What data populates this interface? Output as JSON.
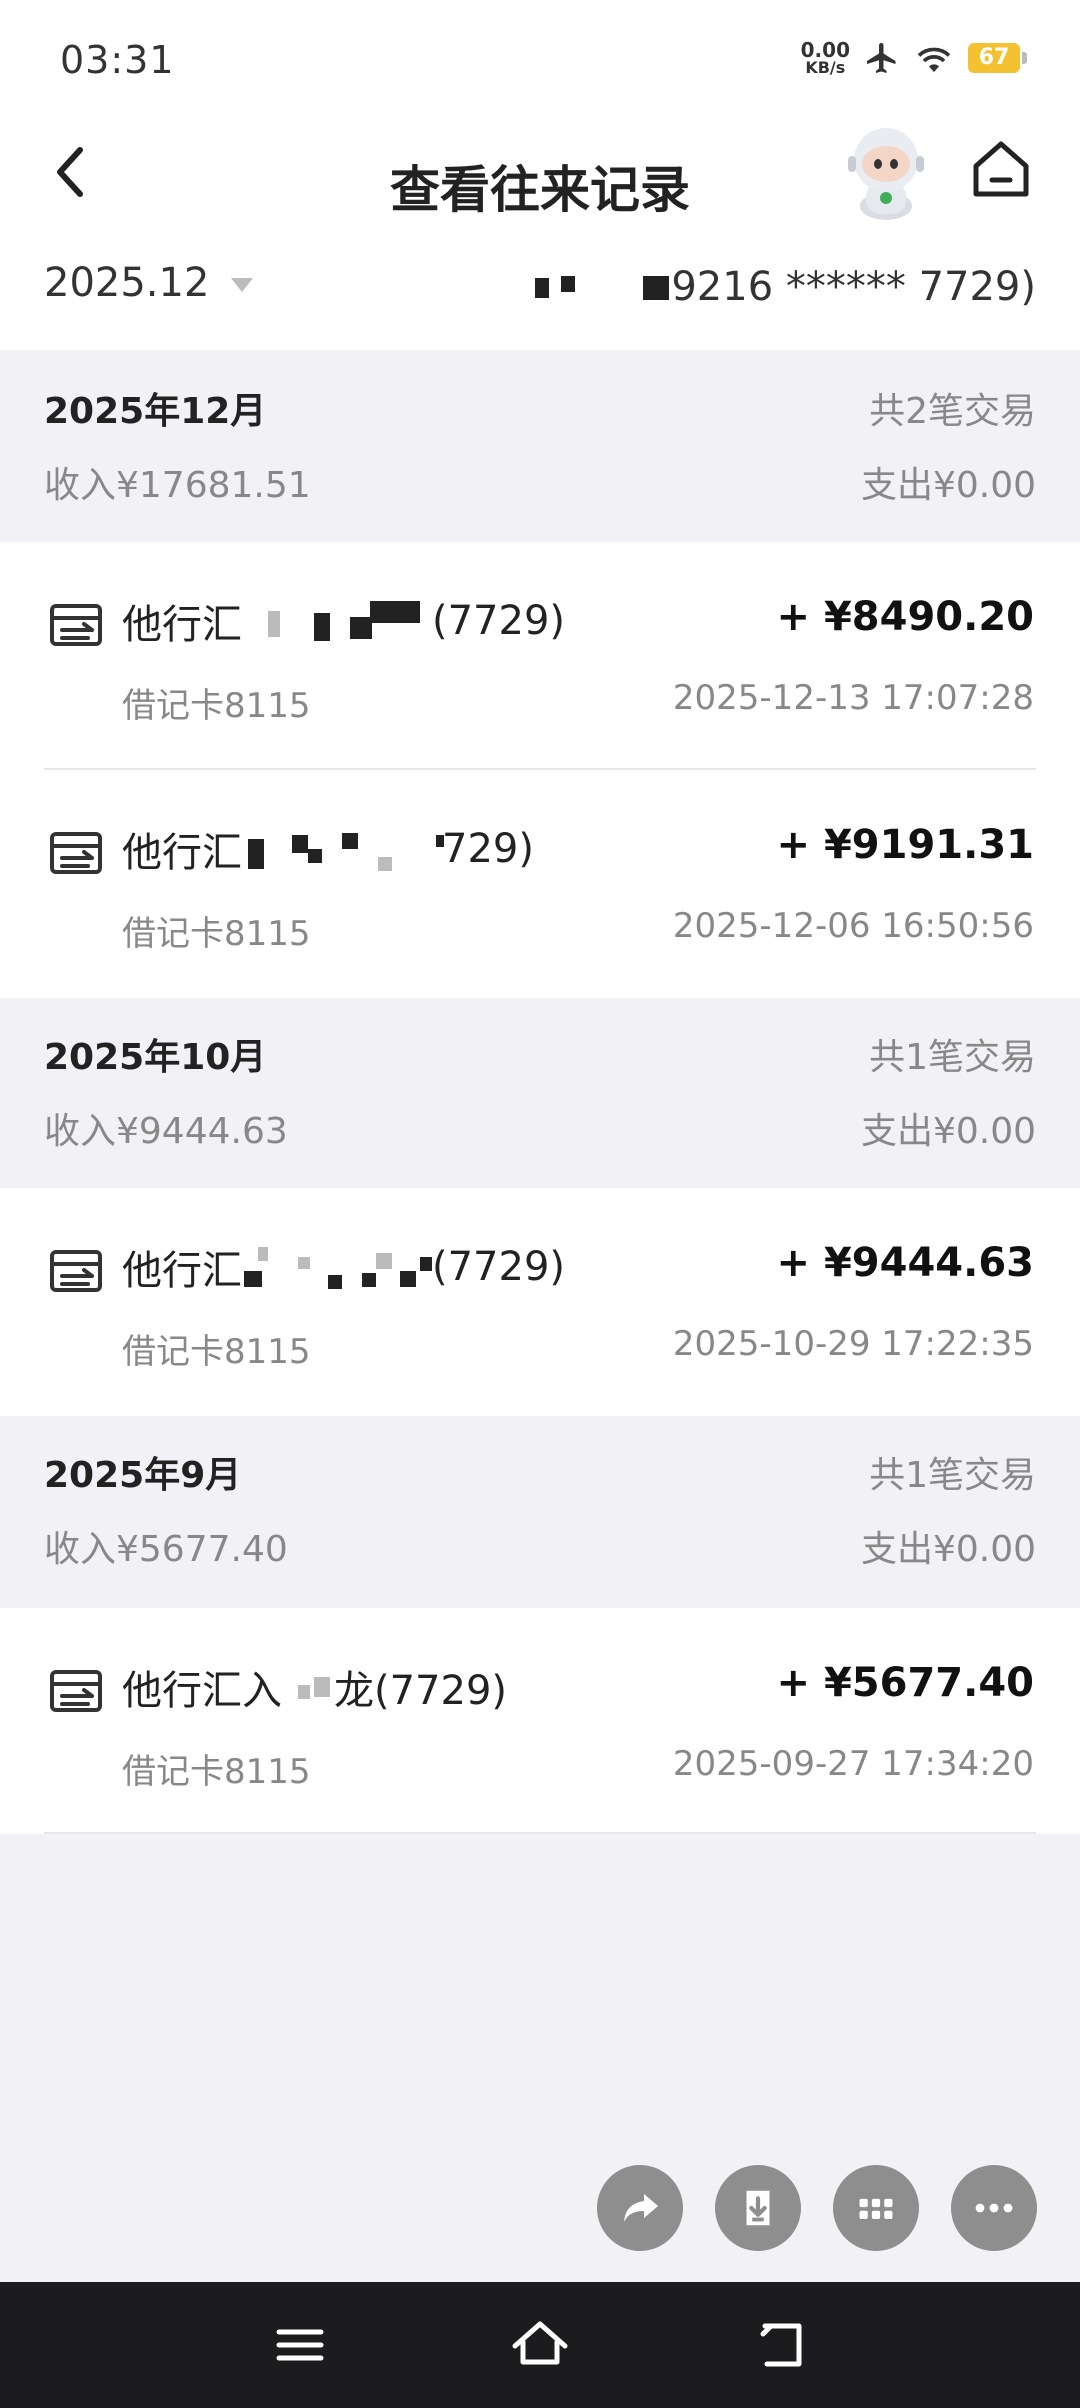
{
  "status_bar": {
    "time": "03:31",
    "net_speed_value": "0.00",
    "net_speed_unit": "KB/s",
    "battery": "67"
  },
  "header": {
    "title": "查看往来记录"
  },
  "filter": {
    "month": "2025.12",
    "account_visible_text": "9216 ****** 7729)"
  },
  "sections": [
    {
      "month": "2025年12月",
      "count": "共2笔交易",
      "income": "收入¥17681.51",
      "expense": "支出¥0.00",
      "transactions": [
        {
          "name_prefix": "他行汇",
          "name_suffix": "(7729)",
          "amount": "+ ¥8490.20",
          "card": "借记卡8115",
          "time": "2025-12-13 17:07:28"
        },
        {
          "name_prefix": "他行汇",
          "name_suffix": "729)",
          "amount": "+ ¥9191.31",
          "card": "借记卡8115",
          "time": "2025-12-06 16:50:56"
        }
      ]
    },
    {
      "month": "2025年10月",
      "count": "共1笔交易",
      "income": "收入¥9444.63",
      "expense": "支出¥0.00",
      "transactions": [
        {
          "name_prefix": "他行汇",
          "name_suffix": "(7729)",
          "amount": "+ ¥9444.63",
          "card": "借记卡8115",
          "time": "2025-10-29 17:22:35"
        }
      ]
    },
    {
      "month": "2025年9月",
      "count": "共1笔交易",
      "income": "收入¥5677.40",
      "expense": "支出¥0.00",
      "transactions": [
        {
          "name_prefix": "他行汇入",
          "name_suffix": "龙(7729)",
          "amount": "+ ¥5677.40",
          "card": "借记卡8115",
          "time": "2025-09-27 17:34:20"
        }
      ]
    }
  ],
  "fabs": [
    "share-icon",
    "download-icon",
    "grid-icon",
    "more-icon"
  ],
  "nav_icons": [
    "menu-icon",
    "home-icon",
    "back-icon"
  ],
  "colors": {
    "section_bg": "#f2f2f6",
    "fab_bg": "#8e8e8e",
    "battery": "#f4c230",
    "nav_bg": "#1c1c1e"
  }
}
